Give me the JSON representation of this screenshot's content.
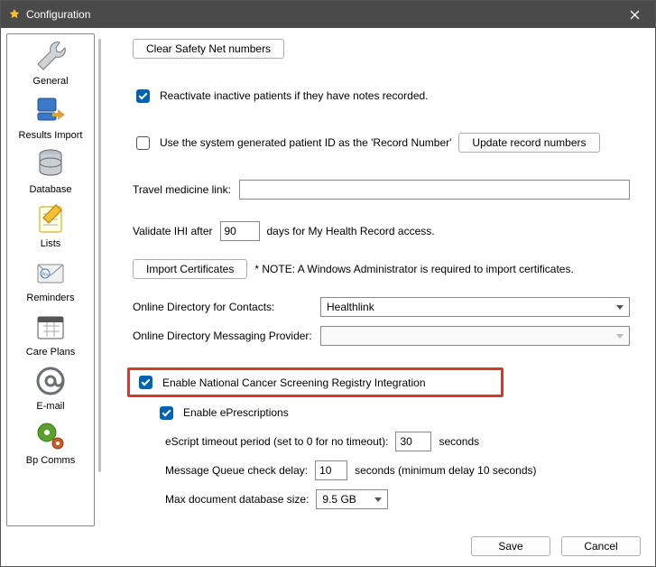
{
  "window": {
    "title": "Configuration"
  },
  "sidebar": {
    "items": [
      {
        "label": "General"
      },
      {
        "label": "Results Import"
      },
      {
        "label": "Database"
      },
      {
        "label": "Lists"
      },
      {
        "label": "Reminders"
      },
      {
        "label": "Care Plans"
      },
      {
        "label": "E-mail"
      },
      {
        "label": "Bp Comms"
      }
    ]
  },
  "main": {
    "clear_safety_net": "Clear Safety Net numbers",
    "reactivate": "Reactivate inactive patients if they have notes recorded.",
    "use_system_id": "Use the system generated patient ID as the 'Record Number'",
    "update_record_numbers": "Update record numbers",
    "travel_link_label": "Travel medicine link:",
    "travel_link_value": "",
    "validate_ihi_pre": "Validate IHI after",
    "validate_ihi_days": "90",
    "validate_ihi_post": "days for My Health Record access.",
    "import_certs": "Import Certificates",
    "import_certs_note": "* NOTE: A Windows Administrator is required to import certificates.",
    "online_dir_contacts_label": "Online Directory for Contacts:",
    "online_dir_contacts_value": "Healthlink",
    "online_dir_msg_label": "Online Directory Messaging Provider:",
    "online_dir_msg_value": "",
    "enable_ncsr": "Enable National Cancer Screening Registry Integration",
    "enable_eprescriptions": "Enable ePrescriptions",
    "escript_timeout_label": "eScript timeout period (set to 0 for no timeout):",
    "escript_timeout_value": "30",
    "escript_timeout_unit": "seconds",
    "mq_delay_label": "Message Queue check delay:",
    "mq_delay_value": "10",
    "mq_delay_suffix": "seconds (minimum delay 10 seconds)",
    "max_db_label": "Max document database size:",
    "max_db_value": "9.5 GB"
  },
  "footer": {
    "save": "Save",
    "cancel": "Cancel"
  }
}
